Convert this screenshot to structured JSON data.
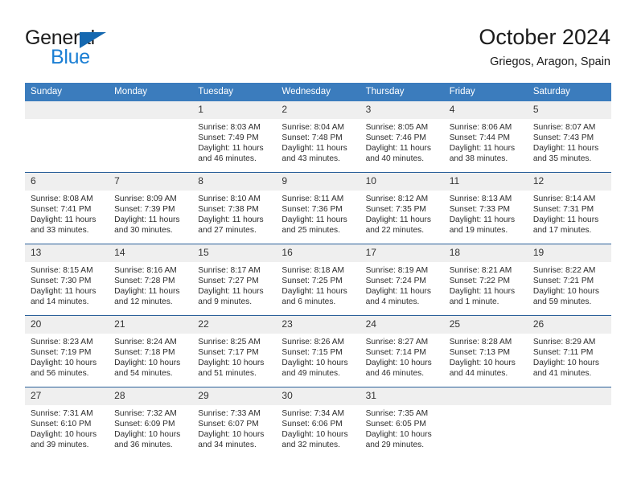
{
  "brand": {
    "word1": "General",
    "word2": "Blue",
    "triangle_color": "#1568b0",
    "blue_color": "#1b7fd4"
  },
  "header": {
    "title": "October 2024",
    "subtitle": "Griegos, Aragon, Spain"
  },
  "theme": {
    "header_bg": "#3b7cbd",
    "row_divider": "#2a6099",
    "daynum_bg": "#efefef"
  },
  "weekday_headers": [
    "Sunday",
    "Monday",
    "Tuesday",
    "Wednesday",
    "Thursday",
    "Friday",
    "Saturday"
  ],
  "weeks": [
    [
      {
        "day": "",
        "sunrise": "",
        "sunset": "",
        "daylight": "",
        "daylight2": ""
      },
      {
        "day": "",
        "sunrise": "",
        "sunset": "",
        "daylight": "",
        "daylight2": ""
      },
      {
        "day": "1",
        "sunrise": "Sunrise: 8:03 AM",
        "sunset": "Sunset: 7:49 PM",
        "daylight": "Daylight: 11 hours",
        "daylight2": "and 46 minutes."
      },
      {
        "day": "2",
        "sunrise": "Sunrise: 8:04 AM",
        "sunset": "Sunset: 7:48 PM",
        "daylight": "Daylight: 11 hours",
        "daylight2": "and 43 minutes."
      },
      {
        "day": "3",
        "sunrise": "Sunrise: 8:05 AM",
        "sunset": "Sunset: 7:46 PM",
        "daylight": "Daylight: 11 hours",
        "daylight2": "and 40 minutes."
      },
      {
        "day": "4",
        "sunrise": "Sunrise: 8:06 AM",
        "sunset": "Sunset: 7:44 PM",
        "daylight": "Daylight: 11 hours",
        "daylight2": "and 38 minutes."
      },
      {
        "day": "5",
        "sunrise": "Sunrise: 8:07 AM",
        "sunset": "Sunset: 7:43 PM",
        "daylight": "Daylight: 11 hours",
        "daylight2": "and 35 minutes."
      }
    ],
    [
      {
        "day": "6",
        "sunrise": "Sunrise: 8:08 AM",
        "sunset": "Sunset: 7:41 PM",
        "daylight": "Daylight: 11 hours",
        "daylight2": "and 33 minutes."
      },
      {
        "day": "7",
        "sunrise": "Sunrise: 8:09 AM",
        "sunset": "Sunset: 7:39 PM",
        "daylight": "Daylight: 11 hours",
        "daylight2": "and 30 minutes."
      },
      {
        "day": "8",
        "sunrise": "Sunrise: 8:10 AM",
        "sunset": "Sunset: 7:38 PM",
        "daylight": "Daylight: 11 hours",
        "daylight2": "and 27 minutes."
      },
      {
        "day": "9",
        "sunrise": "Sunrise: 8:11 AM",
        "sunset": "Sunset: 7:36 PM",
        "daylight": "Daylight: 11 hours",
        "daylight2": "and 25 minutes."
      },
      {
        "day": "10",
        "sunrise": "Sunrise: 8:12 AM",
        "sunset": "Sunset: 7:35 PM",
        "daylight": "Daylight: 11 hours",
        "daylight2": "and 22 minutes."
      },
      {
        "day": "11",
        "sunrise": "Sunrise: 8:13 AM",
        "sunset": "Sunset: 7:33 PM",
        "daylight": "Daylight: 11 hours",
        "daylight2": "and 19 minutes."
      },
      {
        "day": "12",
        "sunrise": "Sunrise: 8:14 AM",
        "sunset": "Sunset: 7:31 PM",
        "daylight": "Daylight: 11 hours",
        "daylight2": "and 17 minutes."
      }
    ],
    [
      {
        "day": "13",
        "sunrise": "Sunrise: 8:15 AM",
        "sunset": "Sunset: 7:30 PM",
        "daylight": "Daylight: 11 hours",
        "daylight2": "and 14 minutes."
      },
      {
        "day": "14",
        "sunrise": "Sunrise: 8:16 AM",
        "sunset": "Sunset: 7:28 PM",
        "daylight": "Daylight: 11 hours",
        "daylight2": "and 12 minutes."
      },
      {
        "day": "15",
        "sunrise": "Sunrise: 8:17 AM",
        "sunset": "Sunset: 7:27 PM",
        "daylight": "Daylight: 11 hours",
        "daylight2": "and 9 minutes."
      },
      {
        "day": "16",
        "sunrise": "Sunrise: 8:18 AM",
        "sunset": "Sunset: 7:25 PM",
        "daylight": "Daylight: 11 hours",
        "daylight2": "and 6 minutes."
      },
      {
        "day": "17",
        "sunrise": "Sunrise: 8:19 AM",
        "sunset": "Sunset: 7:24 PM",
        "daylight": "Daylight: 11 hours",
        "daylight2": "and 4 minutes."
      },
      {
        "day": "18",
        "sunrise": "Sunrise: 8:21 AM",
        "sunset": "Sunset: 7:22 PM",
        "daylight": "Daylight: 11 hours",
        "daylight2": "and 1 minute."
      },
      {
        "day": "19",
        "sunrise": "Sunrise: 8:22 AM",
        "sunset": "Sunset: 7:21 PM",
        "daylight": "Daylight: 10 hours",
        "daylight2": "and 59 minutes."
      }
    ],
    [
      {
        "day": "20",
        "sunrise": "Sunrise: 8:23 AM",
        "sunset": "Sunset: 7:19 PM",
        "daylight": "Daylight: 10 hours",
        "daylight2": "and 56 minutes."
      },
      {
        "day": "21",
        "sunrise": "Sunrise: 8:24 AM",
        "sunset": "Sunset: 7:18 PM",
        "daylight": "Daylight: 10 hours",
        "daylight2": "and 54 minutes."
      },
      {
        "day": "22",
        "sunrise": "Sunrise: 8:25 AM",
        "sunset": "Sunset: 7:17 PM",
        "daylight": "Daylight: 10 hours",
        "daylight2": "and 51 minutes."
      },
      {
        "day": "23",
        "sunrise": "Sunrise: 8:26 AM",
        "sunset": "Sunset: 7:15 PM",
        "daylight": "Daylight: 10 hours",
        "daylight2": "and 49 minutes."
      },
      {
        "day": "24",
        "sunrise": "Sunrise: 8:27 AM",
        "sunset": "Sunset: 7:14 PM",
        "daylight": "Daylight: 10 hours",
        "daylight2": "and 46 minutes."
      },
      {
        "day": "25",
        "sunrise": "Sunrise: 8:28 AM",
        "sunset": "Sunset: 7:13 PM",
        "daylight": "Daylight: 10 hours",
        "daylight2": "and 44 minutes."
      },
      {
        "day": "26",
        "sunrise": "Sunrise: 8:29 AM",
        "sunset": "Sunset: 7:11 PM",
        "daylight": "Daylight: 10 hours",
        "daylight2": "and 41 minutes."
      }
    ],
    [
      {
        "day": "27",
        "sunrise": "Sunrise: 7:31 AM",
        "sunset": "Sunset: 6:10 PM",
        "daylight": "Daylight: 10 hours",
        "daylight2": "and 39 minutes."
      },
      {
        "day": "28",
        "sunrise": "Sunrise: 7:32 AM",
        "sunset": "Sunset: 6:09 PM",
        "daylight": "Daylight: 10 hours",
        "daylight2": "and 36 minutes."
      },
      {
        "day": "29",
        "sunrise": "Sunrise: 7:33 AM",
        "sunset": "Sunset: 6:07 PM",
        "daylight": "Daylight: 10 hours",
        "daylight2": "and 34 minutes."
      },
      {
        "day": "30",
        "sunrise": "Sunrise: 7:34 AM",
        "sunset": "Sunset: 6:06 PM",
        "daylight": "Daylight: 10 hours",
        "daylight2": "and 32 minutes."
      },
      {
        "day": "31",
        "sunrise": "Sunrise: 7:35 AM",
        "sunset": "Sunset: 6:05 PM",
        "daylight": "Daylight: 10 hours",
        "daylight2": "and 29 minutes."
      },
      {
        "day": "",
        "sunrise": "",
        "sunset": "",
        "daylight": "",
        "daylight2": ""
      },
      {
        "day": "",
        "sunrise": "",
        "sunset": "",
        "daylight": "",
        "daylight2": ""
      }
    ]
  ]
}
